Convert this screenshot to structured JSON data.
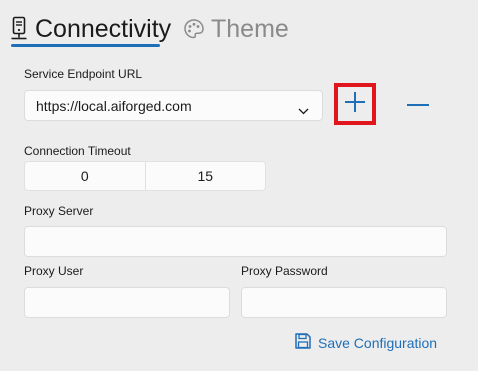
{
  "tabs": {
    "connectivity": {
      "label": "Connectivity",
      "icon": "server-icon",
      "active": true
    },
    "theme": {
      "label": "Theme",
      "icon": "palette-icon",
      "active": false
    }
  },
  "endpoint": {
    "label": "Service Endpoint URL",
    "value": "https://local.aiforged.com"
  },
  "timeout": {
    "label": "Connection Timeout",
    "minutes": "0",
    "seconds": "15"
  },
  "proxy_server": {
    "label": "Proxy Server",
    "value": ""
  },
  "proxy_user": {
    "label": "Proxy User",
    "value": ""
  },
  "proxy_password": {
    "label": "Proxy Password",
    "value": ""
  },
  "save": {
    "label": "Save Configuration",
    "icon": "save-icon"
  },
  "colors": {
    "accent": "#1f6fb8",
    "highlight_border": "#e0161c",
    "background": "#ededed",
    "inactive_tab": "#8a8a8a"
  }
}
